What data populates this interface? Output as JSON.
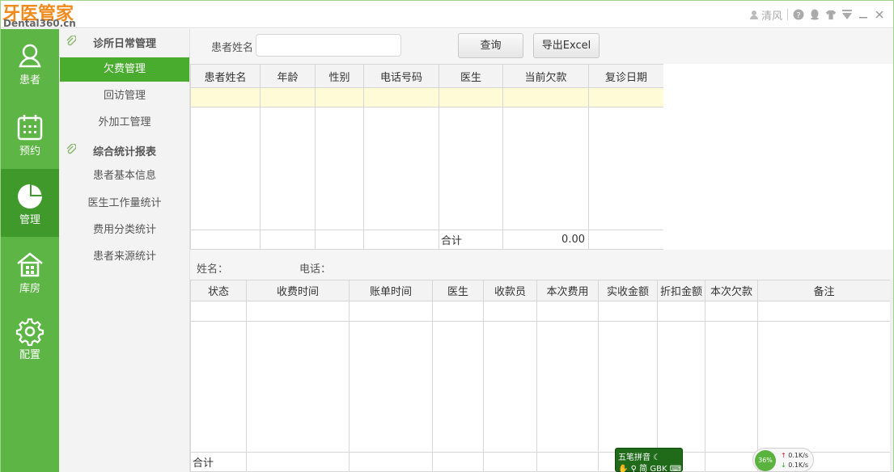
{
  "app": {
    "logo_main": "牙医管家",
    "logo_sub": "Dental360.cn",
    "user_name": "清风"
  },
  "leftnav": [
    {
      "label": "患者",
      "icon": "person-icon"
    },
    {
      "label": "预约",
      "icon": "calendar-icon"
    },
    {
      "label": "管理",
      "icon": "pie-chart-icon"
    },
    {
      "label": "库房",
      "icon": "warehouse-icon"
    },
    {
      "label": "配置",
      "icon": "gear-icon"
    }
  ],
  "submenu": {
    "group1": "诊所日常管理",
    "group1_items": [
      "欠费管理",
      "回访管理",
      "外加工管理"
    ],
    "group2": "综合统计报表",
    "group2_items": [
      "患者基本信息",
      "医生工作量统计",
      "费用分类统计",
      "患者来源统计"
    ]
  },
  "search": {
    "label": "患者姓名",
    "value": "",
    "query_btn": "查询",
    "export_btn": "导出Excel"
  },
  "table1": {
    "headers": [
      "患者姓名",
      "年龄",
      "性别",
      "电话号码",
      "医生",
      "当前欠款",
      "复诊日期"
    ],
    "sum_label": "合计",
    "sum_value": "0.00"
  },
  "info": {
    "name_label": "姓名：",
    "phone_label": "电话："
  },
  "table2": {
    "headers": [
      "状态",
      "收费时间",
      "账单时间",
      "医生",
      "收款员",
      "本次费用",
      "实收金额",
      "折扣金额",
      "本次欠款",
      "备注"
    ],
    "sum_label": "合计"
  },
  "ime": {
    "row1": "五笔拼音",
    "row2": "简 GBK"
  },
  "network": {
    "gauge": "36%",
    "up": "0.1K/s",
    "down": "0.1K/s"
  }
}
